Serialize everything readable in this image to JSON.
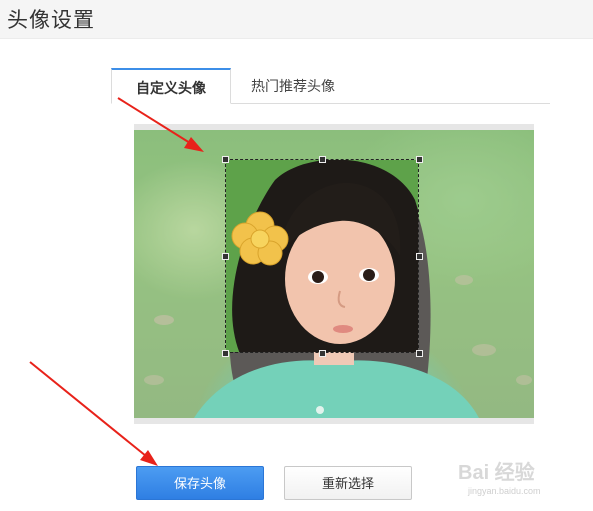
{
  "header": {
    "title": "头像设置"
  },
  "tabs": [
    {
      "label": "自定义头像",
      "active": true
    },
    {
      "label": "热门推荐头像",
      "active": false
    }
  ],
  "colors": {
    "accent": "#3c8ee8",
    "save_button": "#3a8cee",
    "annotation_arrow": "#e8221a"
  },
  "buttons": {
    "save_label": "保存头像",
    "reselect_label": "重新选择"
  },
  "watermark": {
    "brand": "Bai 经验",
    "url": "jingyan.baidu.com"
  }
}
